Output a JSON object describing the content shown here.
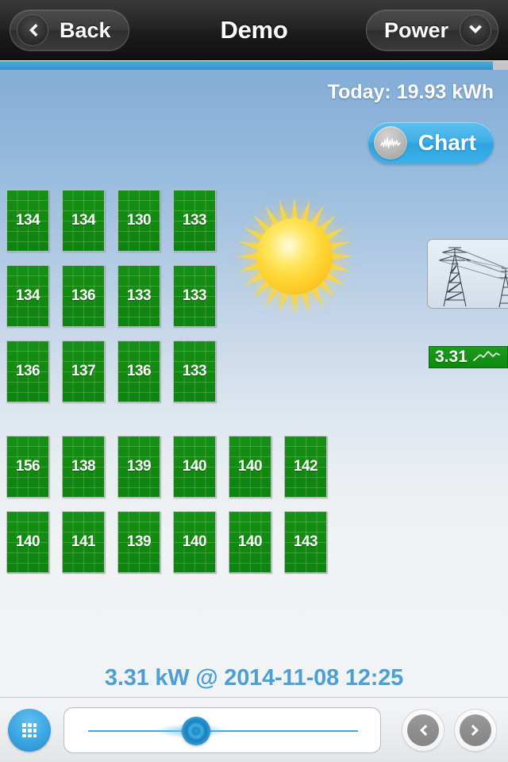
{
  "navbar": {
    "back_label": "Back",
    "back_icon": "chevron-left-icon",
    "title": "Demo",
    "power_label": "Power",
    "power_icon": "chevron-down-icon"
  },
  "progress": {
    "percent": 97,
    "fill_color": "#3d9fd6",
    "track_color": "#c6c6c6"
  },
  "header": {
    "today_label": "Today: 19.93 kWh",
    "chart_button_label": "Chart",
    "chart_button_icon": "waveform-icon",
    "chart_button_color": "#3fb0e8"
  },
  "scene": {
    "sun_icon": "sun-icon",
    "tower_icon": "power-transmission-tower-icon",
    "grid_value": "3.31",
    "grid_spark_icon": "sparkline-icon",
    "grid_value_color": "#149214"
  },
  "panel_groups": [
    {
      "name": "array-1",
      "rows": [
        [
          "134",
          "134",
          "130",
          "133"
        ],
        [
          "134",
          "136",
          "133",
          "133"
        ],
        [
          "136",
          "137",
          "136",
          "133"
        ]
      ]
    },
    {
      "name": "array-2",
      "rows": [
        [
          "156",
          "138",
          "139",
          "140",
          "140",
          "142"
        ],
        [
          "140",
          "141",
          "139",
          "140",
          "140",
          "143"
        ]
      ]
    }
  ],
  "status": {
    "text": "3.31 kW @ 2014-11-08 12:25",
    "color": "#4a9fd4"
  },
  "toolbar": {
    "grid_button_icon": "grid-icon",
    "slider_value_percent": 40,
    "prev_button_icon": "chevron-left-icon",
    "next_button_icon": "chevron-right-icon"
  }
}
